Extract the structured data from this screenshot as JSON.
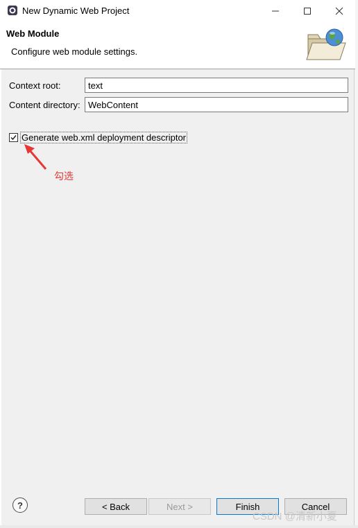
{
  "window": {
    "title": "New Dynamic Web Project"
  },
  "header": {
    "title": "Web Module",
    "description": "Configure web module settings."
  },
  "form": {
    "context_root": {
      "label": "Context root:",
      "value": "text"
    },
    "content_directory": {
      "label": "Content directory:",
      "value": "WebContent"
    },
    "generate_descriptor": {
      "label": "Generate web.xml deployment descriptor",
      "checked": true
    }
  },
  "annotation": {
    "text": "勾选"
  },
  "buttons": {
    "help": "?",
    "back": "< Back",
    "next": "Next >",
    "finish": "Finish",
    "cancel": "Cancel"
  },
  "watermark": "CSDN @清新小夏",
  "colors": {
    "annotation": "#e53935",
    "default_button_border": "#0078d7"
  },
  "icons": [
    "eclipse-app-icon",
    "minimize-icon",
    "maximize-icon",
    "close-icon",
    "web-folder-globe-icon",
    "help-icon",
    "checkmark-icon",
    "red-arrow-annotation"
  ]
}
